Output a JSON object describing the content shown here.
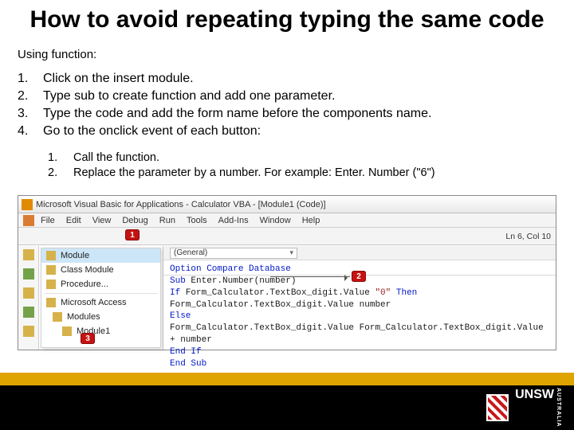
{
  "title": "How to avoid repeating typing the same code",
  "subhead": "Using function:",
  "steps": [
    "Click on the insert module.",
    "Type sub to create function and add one parameter.",
    "Type the code and add the form name before the components name.",
    "Go to the onclick event of each button:"
  ],
  "substeps": [
    "Call the function.",
    "Replace the parameter by a number. For example: Enter. Number (\"6\")"
  ],
  "ide": {
    "title": "Microsoft Visual Basic for Applications - Calculator VBA - [Module1 (Code)]",
    "menus": [
      "File",
      "Edit",
      "View",
      "Debug",
      "Run",
      "Tools",
      "Add-Ins",
      "Window",
      "Help"
    ],
    "status": "Ln 6, Col 10",
    "tree": {
      "items": [
        "Module",
        "Class Module",
        "Procedure..."
      ],
      "section": "Microsoft Access",
      "sub1": "Modules",
      "sub2": "Module1"
    },
    "dropdown": "(General)",
    "code": {
      "l1a": "Option Compare Database",
      "l2a": "Sub",
      "l2b": " Enter.Number(number)",
      "l3a": "If",
      "l3b": " Form_Calculator.TextBox_digit.Value   ",
      "l3c": "\"0\"",
      "l3d": " Then",
      "l4": "Form_Calculator.TextBox_digit.Value   number",
      "l5": "Else",
      "l6": "Form_Calculator.TextBox_digit.Value   Form_Calculator.TextBox_digit.Value + number",
      "l7": "End If",
      "l8": "End Sub"
    }
  },
  "callouts": {
    "c1": "1",
    "c2": "2",
    "c3": "3"
  },
  "footer": {
    "brand": "UNSW",
    "country": "AUSTRALIA"
  }
}
